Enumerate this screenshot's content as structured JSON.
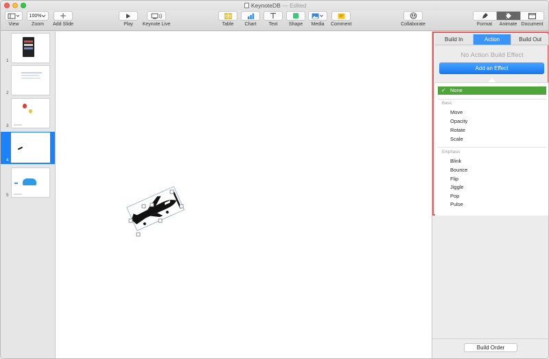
{
  "window": {
    "title": "KeynoteDB",
    "title_suffix": "— Edited"
  },
  "toolbar": {
    "view": "View",
    "zoom": "Zoom",
    "zoom_value": "100%",
    "add_slide": "Add Slide",
    "play": "Play",
    "keynote_live": "Keynote Live",
    "table": "Table",
    "chart": "Chart",
    "text": "Text",
    "shape": "Shape",
    "media": "Media",
    "comment": "Comment",
    "collaborate": "Collaborate",
    "format": "Format",
    "animate": "Animate",
    "document": "Document"
  },
  "navigator": {
    "slides": [
      {
        "number": "1",
        "selected": false
      },
      {
        "number": "2",
        "selected": false
      },
      {
        "number": "3",
        "selected": false
      },
      {
        "number": "4",
        "selected": true
      },
      {
        "number": "5",
        "selected": false
      }
    ]
  },
  "inspector": {
    "tabs": [
      "Build In",
      "Action",
      "Build Out"
    ],
    "active_tab": "Action",
    "no_effect_text": "No Action Build Effect",
    "add_effect_button": "Add an Effect",
    "selected_effect": "None",
    "groups": [
      {
        "header": "Basic",
        "items": [
          "Move",
          "Opacity",
          "Rotate",
          "Scale"
        ]
      },
      {
        "header": "Emphasis",
        "items": [
          "Blink",
          "Bounce",
          "Flip",
          "Jiggle",
          "Pop",
          "Pulse"
        ]
      }
    ],
    "build_order_button": "Build Order"
  },
  "colors": {
    "accent_blue": "#1a82fb",
    "selected_green": "#4ea63a",
    "highlight_red": "#e25c57"
  }
}
